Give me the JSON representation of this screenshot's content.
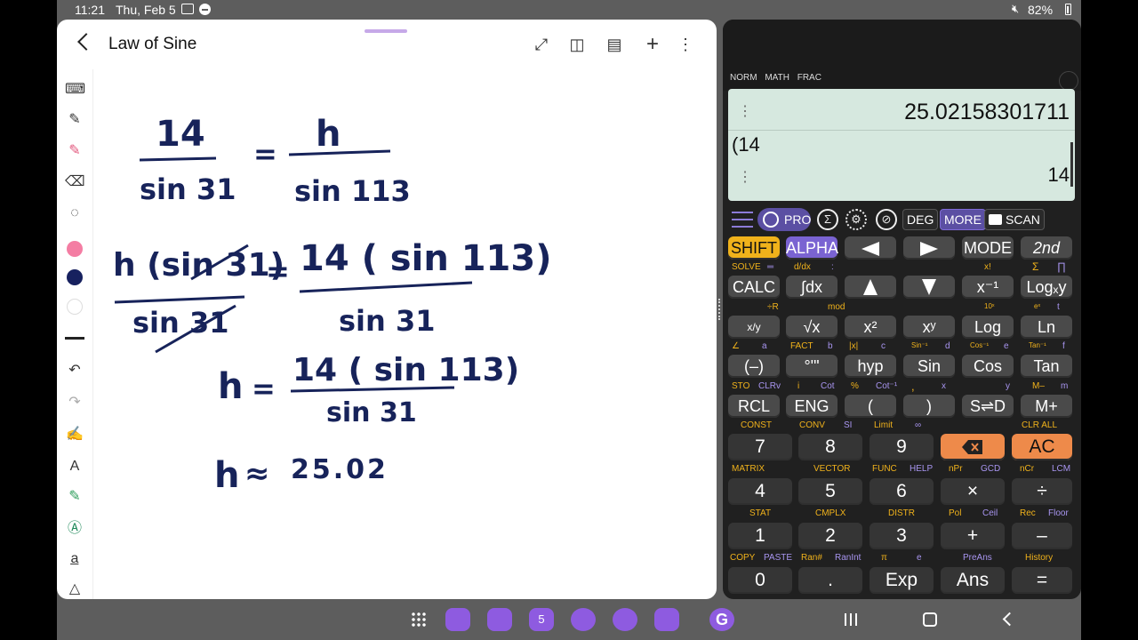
{
  "status_bar": {
    "time": "11:21",
    "date": "Thu, Feb 5",
    "battery": "82%"
  },
  "notes": {
    "title": "Law of Sine",
    "handwriting": {
      "line1_num_left": "14",
      "line1_den_left": "sin 31",
      "line1_num_right": "h",
      "line1_den_right": "sin 113",
      "line2_num_left": "h (sin 31)",
      "line2_den_left": "sin 31",
      "line2_num_right": "14 ( sin 113)",
      "line2_den_right": "sin 31",
      "line3_lhs": "h",
      "line3_num": "14 ( sin 113)",
      "line3_den": "sin 31",
      "line4_lhs": "h",
      "line4_rhs": "25.02",
      "eq": "=",
      "approx": "≈"
    },
    "colors": {
      "ink": "#17235a",
      "pink": "#f06292",
      "navy": "#17215f"
    }
  },
  "calculator": {
    "modes": [
      "NORM",
      "MATH",
      "FRAC"
    ],
    "result_1": "25.02158301711",
    "expression": "(14",
    "result_2": "14",
    "pro_label": "PRO",
    "deg_label": "DEG",
    "more_label": "MORE",
    "scan_label": "SCAN",
    "rows": {
      "r1": {
        "shift": "SHIFT",
        "alpha": "ALPHA",
        "mode": "MODE",
        "second": "2nd"
      },
      "r1_sub": {
        "solve": "SOLVE",
        "eq": "═",
        "ddx": "d/dx",
        "colon": ":",
        "fact": "x!",
        "sum": "Σ",
        "prod": "∏"
      },
      "r2": {
        "calc": "CALC",
        "int": "∫dx",
        "xinv": "x⁻¹",
        "logxy": "Logₓy"
      },
      "r2_sub": {
        "a": "÷R",
        "b": "mod",
        "c": "10ˣ",
        "d": "eˣ",
        "e": "t"
      },
      "r3": {
        "frac": "x/y",
        "sqrt": "√x",
        "x2": "x²",
        "xy": "xʸ",
        "log": "Log",
        "ln": "Ln"
      },
      "r3_sub": {
        "angle": "∠",
        "a": "a",
        "fact": "FACT",
        "b": "b",
        "abs": "|x|",
        "c": "c",
        "sininv": "Sin⁻¹",
        "d": "d",
        "cosinv": "Cos⁻¹",
        "e": "e",
        "taninv": "Tan⁻¹",
        "f": "f"
      },
      "r4": {
        "neg": "(–)",
        "deg": "°'\"",
        "hyp": "hyp",
        "sin": "Sin",
        "cos": "Cos",
        "tan": "Tan"
      },
      "r4_sub": {
        "sto": "STO",
        "clrv": "CLRv",
        "i": "i",
        "cot": "Cot",
        "pct": "%",
        "cotinv": "Cot⁻¹",
        "comma": ",",
        "x": "x",
        "y": "y",
        "mminus": "M–",
        "m": "m"
      },
      "r5": {
        "rcl": "RCL",
        "eng": "ENG",
        "lp": "(",
        "rp": ")",
        "sd": "S⇌D",
        "mplus": "M+"
      },
      "r5_sub": {
        "const": "CONST",
        "conv": "CONV",
        "si": "SI",
        "limit": "Limit",
        "inf": "∞",
        "clrall": "CLR ALL"
      },
      "r6": {
        "k7": "7",
        "k8": "8",
        "k9": "9",
        "ac": "AC"
      },
      "r6_sub": {
        "matrix": "MATRIX",
        "vector": "VECTOR",
        "func": "FUNC",
        "help": "HELP",
        "npr": "nPr",
        "gcd": "GCD",
        "ncr": "nCr",
        "lcm": "LCM"
      },
      "r7": {
        "k4": "4",
        "k5": "5",
        "k6": "6",
        "mul": "×",
        "div": "÷"
      },
      "r7_sub": {
        "stat": "STAT",
        "cmplx": "CMPLX",
        "distr": "DISTR",
        "pol": "Pol",
        "ceil": "Ceil",
        "rec": "Rec",
        "floor": "Floor"
      },
      "r8": {
        "k1": "1",
        "k2": "2",
        "k3": "3",
        "plus": "+",
        "minus": "–"
      },
      "r8_sub": {
        "copy": "COPY",
        "paste": "PASTE",
        "ran": "Ran#",
        "ranint": "RanInt",
        "pi": "π",
        "e": "e",
        "preans": "PreAns",
        "history": "History"
      },
      "r9": {
        "k0": "0",
        "dot": ".",
        "exp": "Exp",
        "ans": "Ans",
        "eq": "="
      }
    },
    "colors": {
      "display": "#d6e8df",
      "shift": "#f0b21b",
      "alpha": "#7a63d2",
      "orange": "#ee8a4a"
    }
  },
  "dock": {
    "items": [
      "notes-app-icon",
      "files-icon",
      "calendar-icon",
      "messages-icon",
      "browser-icon",
      "camera-icon",
      "google-icon"
    ],
    "calendar_day": "5"
  }
}
